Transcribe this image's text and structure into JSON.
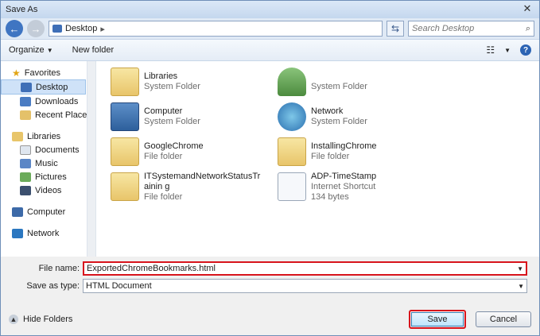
{
  "window": {
    "title": "Save As",
    "close_glyph": "✕"
  },
  "address_bar": {
    "back_icon": "back-arrow-icon",
    "forward_icon": "forward-arrow-icon",
    "location": "Desktop",
    "search_placeholder": "Search Desktop"
  },
  "toolbar": {
    "organize_label": "Organize",
    "new_folder_label": "New folder"
  },
  "sidebar": {
    "favorites_label": "Favorites",
    "favorites": [
      "Desktop",
      "Downloads",
      "Recent Places"
    ],
    "libraries_label": "Libraries",
    "libraries": [
      "Documents",
      "Music",
      "Pictures",
      "Videos"
    ],
    "computer_label": "Computer",
    "network_label": "Network",
    "selected": "Desktop"
  },
  "files": [
    {
      "name": "Libraries",
      "type": "System Folder",
      "icon": "libraries-icon"
    },
    {
      "name": "",
      "type": "System Folder",
      "icon": "user-folder-icon"
    },
    {
      "name": "Computer",
      "type": "System Folder",
      "icon": "computer-icon"
    },
    {
      "name": "Network",
      "type": "System Folder",
      "icon": "network-icon"
    },
    {
      "name": "GoogleChrome",
      "type": "File folder",
      "icon": "folder-icon"
    },
    {
      "name": "InstallingChrome",
      "type": "File folder",
      "icon": "folder-icon"
    },
    {
      "name": "ITSystemandNetworkStatusTrainin g",
      "type": "File folder",
      "icon": "folder-icon"
    },
    {
      "name": "ADP-TimeStamp",
      "type": "Internet Shortcut",
      "size": "134 bytes",
      "icon": "internet-shortcut-icon"
    }
  ],
  "form": {
    "file_name_label": "File name:",
    "file_name_value": "ExportedChromeBookmarks.html",
    "save_type_label": "Save as type:",
    "save_type_value": "HTML Document"
  },
  "footer": {
    "hide_folders_label": "Hide Folders",
    "save_label": "Save",
    "cancel_label": "Cancel"
  },
  "colors": {
    "highlight_red": "#d8141c",
    "selection_blue": "#cfe2f8"
  }
}
